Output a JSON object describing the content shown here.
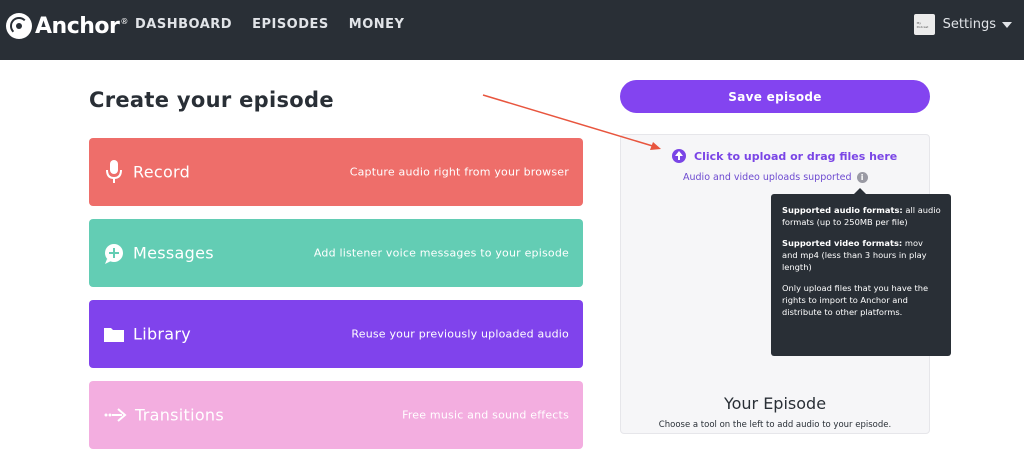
{
  "brand": {
    "name": "Anchor",
    "mark": "®"
  },
  "nav": {
    "items": [
      "DASHBOARD",
      "EPISODES",
      "MONEY"
    ]
  },
  "settings": {
    "label": "Settings",
    "avatar_lines": [
      "My",
      "Podcast"
    ]
  },
  "page": {
    "title": "Create your episode"
  },
  "tools": [
    {
      "name": "Record",
      "description": "Capture audio right from your browser",
      "icon": "microphone-icon",
      "color": "#ee6e6a"
    },
    {
      "name": "Messages",
      "description": "Add listener voice messages to your episode",
      "icon": "message-plus-icon",
      "color": "#63cdb4"
    },
    {
      "name": "Library",
      "description": "Reuse your previously uploaded audio",
      "icon": "folder-icon",
      "color": "#8043ec"
    },
    {
      "name": "Transitions",
      "description": "Free music and sound effects",
      "icon": "transition-arrow-icon",
      "color": "#f3aee0"
    }
  ],
  "save": {
    "label": "Save episode"
  },
  "upload": {
    "link": "Click to upload or drag files here",
    "sub": "Audio and video uploads supported",
    "info": "i"
  },
  "tooltip": {
    "audio_title": "Supported audio formats:",
    "audio_text": " all audio formats (up to 250MB per file)",
    "video_title": "Supported video formats:",
    "video_text": " mov and mp4 (less than 3 hours in play length)",
    "rights_text": "Only upload files that you have the rights to import to Anchor and distribute to other platforms."
  },
  "episode": {
    "title": "Your Episode",
    "desc": "Choose a tool on the left to add audio to your episode."
  },
  "colors": {
    "accent": "#8344f0",
    "nav_bg": "#292f36",
    "annotation_arrow": "#e8553e"
  }
}
